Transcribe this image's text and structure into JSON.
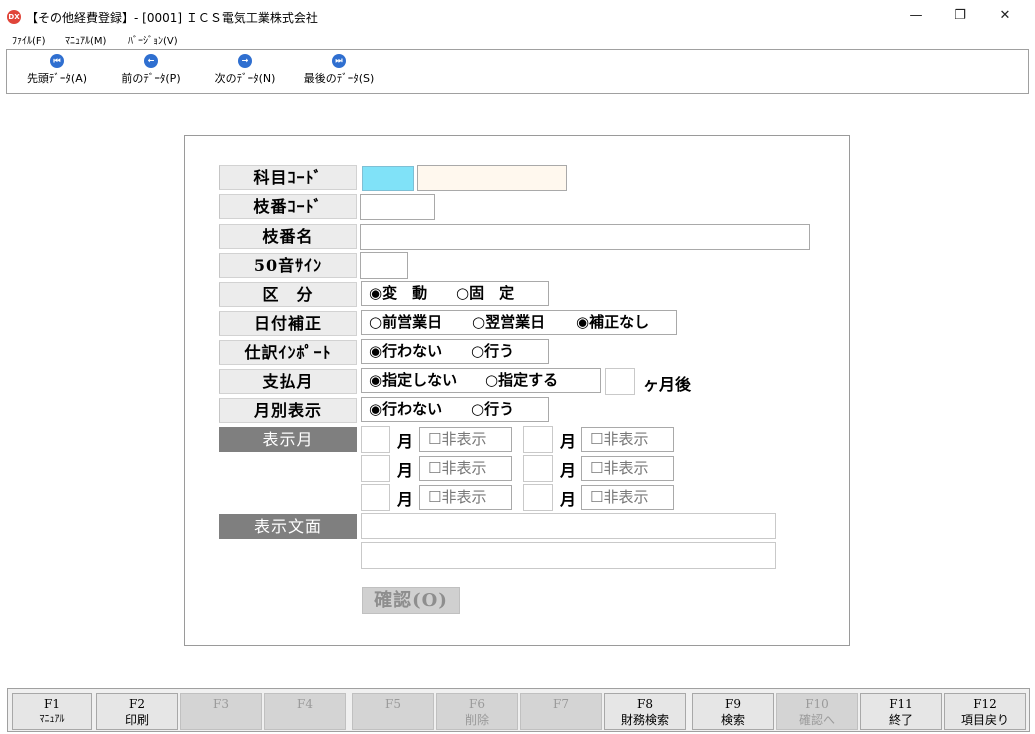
{
  "window": {
    "app_icon": "DX",
    "title": "【その他経費登録】- [0001] ＩＣＳ電気工業株式会社",
    "minimize": "—",
    "restore": "❐",
    "close": "✕"
  },
  "menu": {
    "file": "ﾌｧｲﾙ(F)",
    "manual": "ﾏﾆｭｱﾙ(M)",
    "version": "ﾊﾞｰｼﾞｮﾝ(V)"
  },
  "toolbar": {
    "first": "先頭ﾃﾞｰﾀ(A)",
    "prev": "前のﾃﾞｰﾀ(P)",
    "next": "次のﾃﾞｰﾀ(N)",
    "last": "最後のﾃﾞｰﾀ(S)",
    "icon_first": "⏮",
    "icon_prev": "←",
    "icon_next": "→",
    "icon_last": "⏭"
  },
  "form": {
    "kamoku_code": "科目ｺｰﾄﾞ",
    "edaban_code": "枝番ｺｰﾄﾞ",
    "edaban_name": "枝番名",
    "sakuin": "50音ｻｲﾝ",
    "kubun": "区　分",
    "kubun_opt1": "◉変　動",
    "kubun_opt2": "○固　定",
    "hizuke": "日付補正",
    "hizuke_opt1": "○前営業日",
    "hizuke_opt2": "○翌営業日",
    "hizuke_opt3": "◉補正なし",
    "shiwake": "仕訳ｲﾝﾎﾟｰﾄ",
    "shiwake_opt1": "◉行わない",
    "shiwake_opt2": "○行う",
    "shiharai": "支払月",
    "shiharai_opt1": "◉指定しない",
    "shiharai_opt2": "○指定する",
    "shiharai_suffix": "ヶ月後",
    "getsubetsu": "月別表示",
    "getsubetsu_opt1": "◉行わない",
    "getsubetsu_opt2": "○行う",
    "hyoji_tsuki": "表示月",
    "month_unit": "月",
    "hide_label": "☐非表示",
    "hyoji_bunmen": "表示文面",
    "confirm": "確認(O)"
  },
  "fkeys": [
    {
      "key": "F1",
      "label": "ﾏﾆｭｱﾙ"
    },
    {
      "key": "F2",
      "label": "印刷"
    },
    {
      "key": "F3",
      "label": ""
    },
    {
      "key": "F4",
      "label": ""
    },
    {
      "key": "F5",
      "label": ""
    },
    {
      "key": "F6",
      "label": "削除"
    },
    {
      "key": "F7",
      "label": ""
    },
    {
      "key": "F8",
      "label": "財務検索"
    },
    {
      "key": "F9",
      "label": "検索"
    },
    {
      "key": "F10",
      "label": "確認へ"
    },
    {
      "key": "F11",
      "label": "終了"
    },
    {
      "key": "F12",
      "label": "項目戻り"
    }
  ]
}
